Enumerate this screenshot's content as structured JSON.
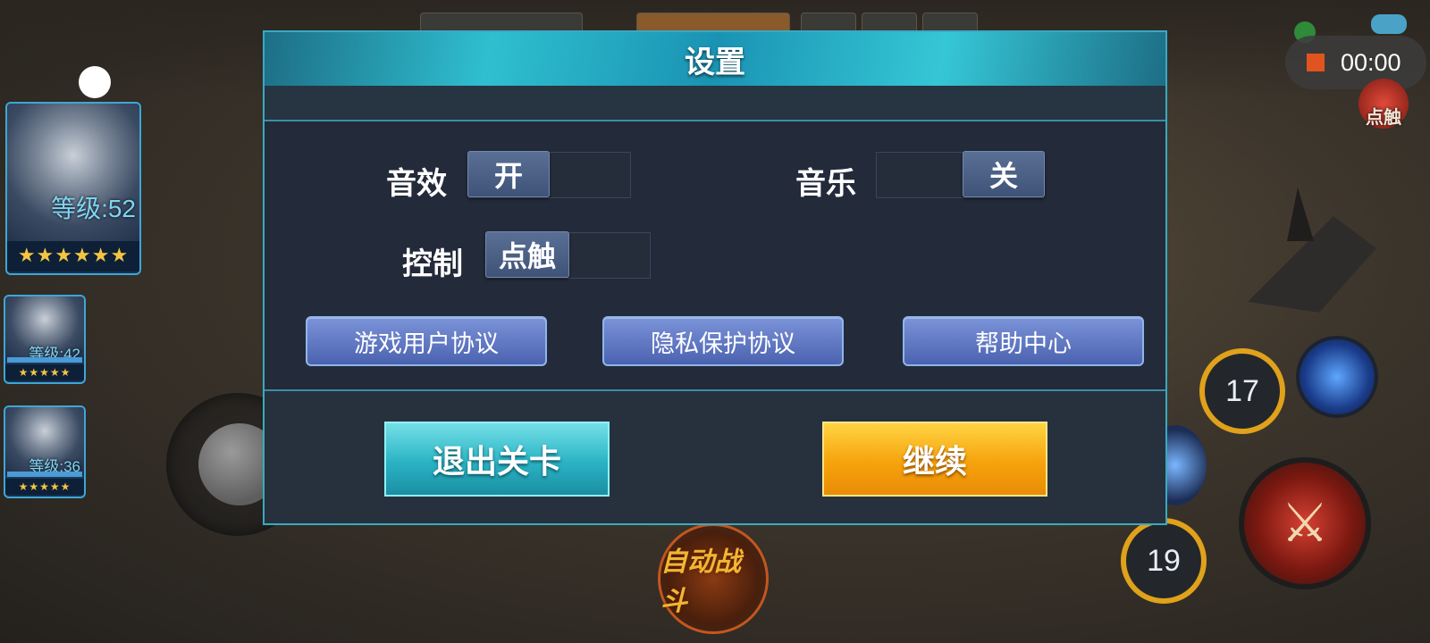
{
  "dialog": {
    "title": "设置",
    "sound": {
      "label": "音效",
      "state_label": "开",
      "state": "on"
    },
    "music": {
      "label": "音乐",
      "state_label": "关",
      "state": "off"
    },
    "control": {
      "label": "控制",
      "state_label": "点触"
    },
    "links": [
      {
        "label": "游戏用户协议"
      },
      {
        "label": "隐私保护协议"
      },
      {
        "label": "帮助中心"
      }
    ],
    "exit_label": "退出关卡",
    "continue_label": "继续"
  },
  "heroes": [
    {
      "level": "等级:52",
      "stars": "★★★★★★"
    },
    {
      "level": "等级:42",
      "stars": "★★★★★"
    },
    {
      "level": "等级:36",
      "stars": "★★★★★"
    }
  ],
  "hud": {
    "recorder_time": "00:00",
    "touch_label": "点触",
    "skill_cooldowns": [
      "17",
      "19"
    ],
    "auto_battle_label": "自动战斗"
  },
  "colors": {
    "dialog_border": "#3aa9c2",
    "exit_button": "#2ab3c4",
    "continue_button": "#f6a30c",
    "link_button": "#5a72c0"
  }
}
